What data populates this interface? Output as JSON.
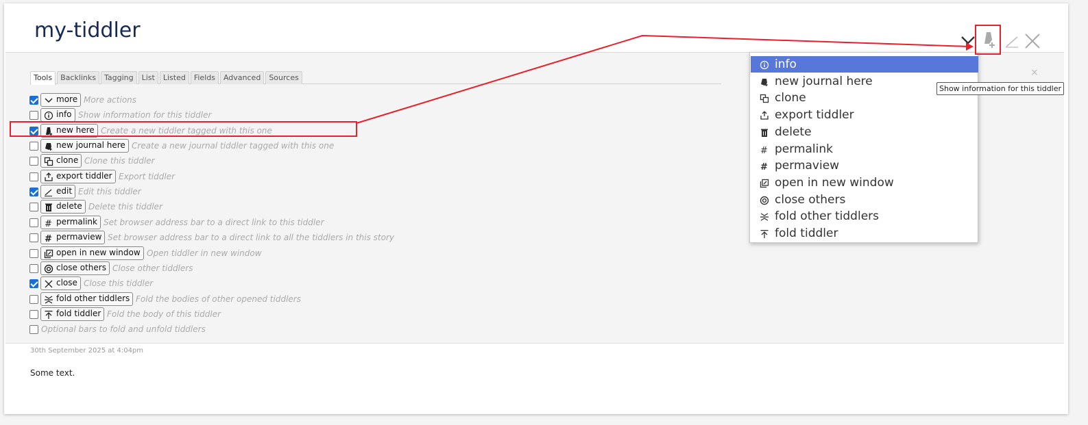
{
  "tiddler": {
    "title": "my-tiddler",
    "date": "30th September 2025 at 4:04pm",
    "body": "Some text."
  },
  "tabs": [
    "Tools",
    "Backlinks",
    "Tagging",
    "List",
    "Listed",
    "Fields",
    "Advanced",
    "Sources"
  ],
  "tools": [
    {
      "checked": true,
      "label": "more",
      "icon": "chevron-down-icon",
      "desc": "More actions"
    },
    {
      "checked": false,
      "label": "info",
      "icon": "info-icon",
      "desc": "Show information for this tiddler"
    },
    {
      "checked": true,
      "label": "new here",
      "icon": "new-here-icon",
      "desc": "Create a new tiddler tagged with this one"
    },
    {
      "checked": false,
      "label": "new journal here",
      "icon": "new-journal-icon",
      "desc": "Create a new journal tiddler tagged with this one"
    },
    {
      "checked": false,
      "label": "clone",
      "icon": "clone-icon",
      "desc": "Clone this tiddler"
    },
    {
      "checked": false,
      "label": "export tiddler",
      "icon": "export-icon",
      "desc": "Export tiddler"
    },
    {
      "checked": true,
      "label": "edit",
      "icon": "edit-icon",
      "desc": "Edit this tiddler"
    },
    {
      "checked": false,
      "label": "delete",
      "icon": "delete-icon",
      "desc": "Delete this tiddler"
    },
    {
      "checked": false,
      "label": "permalink",
      "icon": "permalink-icon",
      "desc": "Set browser address bar to a direct link to this tiddler"
    },
    {
      "checked": false,
      "label": "permaview",
      "icon": "permaview-icon",
      "desc": "Set browser address bar to a direct link to all the tiddlers in this story"
    },
    {
      "checked": false,
      "label": "open in new window",
      "icon": "open-window-icon",
      "desc": "Open tiddler in new window"
    },
    {
      "checked": false,
      "label": "close others",
      "icon": "close-others-icon",
      "desc": "Close other tiddlers"
    },
    {
      "checked": true,
      "label": "close",
      "icon": "close-icon",
      "desc": "Close this tiddler"
    },
    {
      "checked": false,
      "label": "fold other tiddlers",
      "icon": "fold-others-icon",
      "desc": "Fold the bodies of other opened tiddlers"
    },
    {
      "checked": false,
      "label": "fold tiddler",
      "icon": "fold-icon",
      "desc": "Fold the body of this tiddler"
    }
  ],
  "fold_bar_option": "Optional bars to fold and unfold tiddlers",
  "dropdown": {
    "items": [
      {
        "label": "info",
        "icon": "info-icon",
        "active": true
      },
      {
        "label": "new journal here",
        "icon": "new-journal-icon"
      },
      {
        "label": "clone",
        "icon": "clone-icon"
      },
      {
        "label": "export tiddler",
        "icon": "export-icon"
      },
      {
        "label": "delete",
        "icon": "delete-icon"
      },
      {
        "label": "permalink",
        "icon": "permalink-icon"
      },
      {
        "label": "permaview",
        "icon": "permaview-icon"
      },
      {
        "label": "open in new window",
        "icon": "open-window-icon"
      },
      {
        "label": "close others",
        "icon": "close-others-icon"
      },
      {
        "label": "fold other tiddlers",
        "icon": "fold-others-icon"
      },
      {
        "label": "fold tiddler",
        "icon": "fold-icon"
      }
    ]
  },
  "tooltip": "Show information for this tiddler",
  "panel_close": "×",
  "colors": {
    "title": "#182955",
    "menu_highlight": "#5778d8",
    "annotation": "#e8202a",
    "checkbox": "#1a6fd6"
  }
}
